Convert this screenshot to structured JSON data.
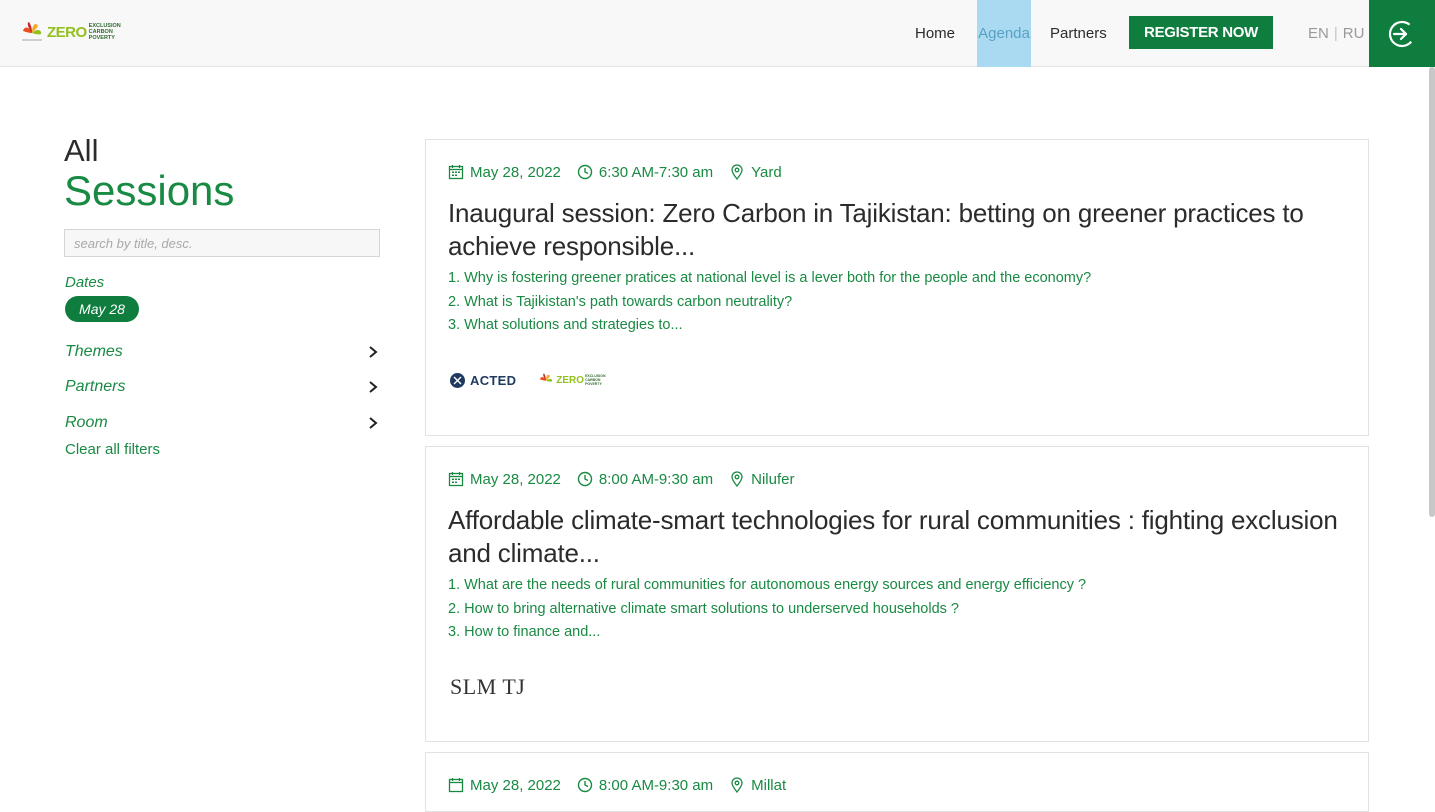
{
  "header": {
    "logo_word": "ZERO",
    "logo_lines": [
      "EXCLUSION",
      "CARBON",
      "POVERTY"
    ],
    "nav": [
      {
        "label": "Home"
      },
      {
        "label": "Agenda"
      },
      {
        "label": "Partners"
      }
    ],
    "register_label": "REGISTER NOW",
    "lang_en": "EN",
    "lang_sep": "|",
    "lang_ru": "RU",
    "login_icon": "sign-in-icon"
  },
  "sidebar": {
    "title_line1": "All",
    "title_line2": "Sessions",
    "search_placeholder": "search by title, desc.",
    "dates_label": "Dates",
    "date_pill": "May 28",
    "filters": [
      {
        "label": "Themes"
      },
      {
        "label": "Partners"
      },
      {
        "label": "Room"
      }
    ],
    "clear_label": "Clear all filters"
  },
  "sessions": [
    {
      "date": "May 28, 2022",
      "time": "6:30 AM-7:30 am",
      "room": "Yard",
      "title": "Inaugural session: Zero Carbon in Tajikistan: betting on greener practices to achieve responsible...",
      "desc": [
        "1. Why is fostering greener pratices at national level is a lever both for the people and the economy?",
        "2. What is Tajikistan's path towards carbon neutrality?",
        "3. What solutions and strategies to..."
      ],
      "partner_acted": "ACTED",
      "partner_zero": "ZERO",
      "partner_zero_lines": [
        "EXCLUSION",
        "CARBON",
        "POVERTY"
      ]
    },
    {
      "date": "May 28, 2022",
      "time": "8:00 AM-9:30 am",
      "room": "Nilufer",
      "title": "Affordable climate-smart technologies for rural communities : fighting exclusion and climate...",
      "desc": [
        "1. What are the needs of rural communities for autonomous energy sources and energy efficiency ?",
        "2. How to bring alternative climate smart solutions to underserved households ?",
        "3. How to finance and..."
      ],
      "partner_slm": "SLM TJ"
    },
    {
      "date": "May 28, 2022",
      "time": "8:00 AM-9:30 am",
      "room": "Millat"
    }
  ],
  "colors": {
    "brand_green": "#0e7d3d",
    "text_green": "#198a43",
    "agenda_active_bg": "#a9daf2",
    "logo_lime": "#93c01f"
  }
}
